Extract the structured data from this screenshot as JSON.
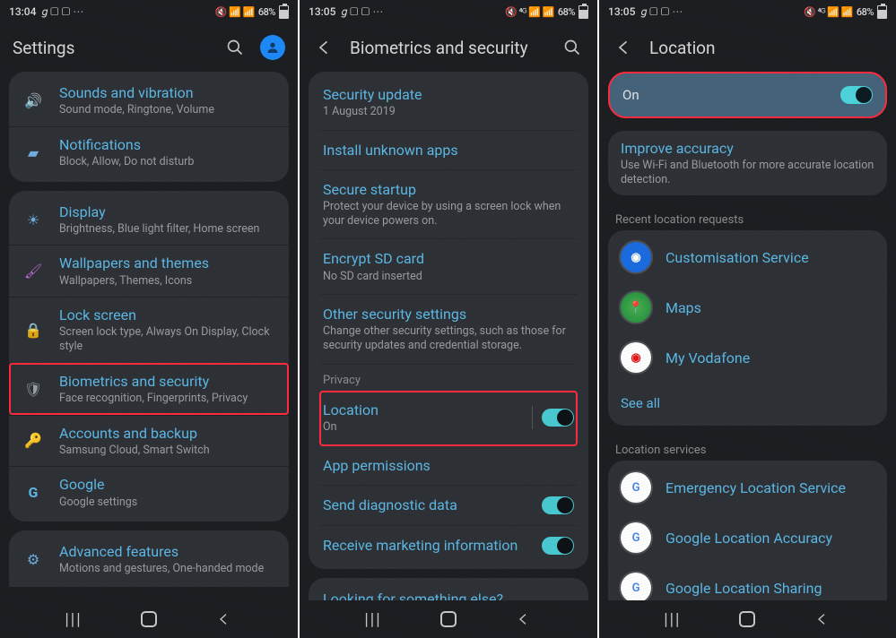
{
  "status": {
    "time1": "13:04",
    "time2": "13:05",
    "time3": "13:05",
    "left_icons": "9 ⬚ ⬚ ⋯",
    "right_text": "68%"
  },
  "panel1": {
    "title": "Settings",
    "groups": [
      [
        {
          "icon": "sound",
          "title": "Sounds and vibration",
          "sub": "Sound mode, Ringtone, Volume"
        },
        {
          "icon": "notif",
          "title": "Notifications",
          "sub": "Block, Allow, Do not disturb"
        }
      ],
      [
        {
          "icon": "display",
          "title": "Display",
          "sub": "Brightness, Blue light filter, Home screen"
        },
        {
          "icon": "wallpaper",
          "title": "Wallpapers and themes",
          "sub": "Wallpapers, Themes, Icons"
        },
        {
          "icon": "lock",
          "title": "Lock screen",
          "sub": "Screen lock type, Always On Display, Clock style"
        },
        {
          "icon": "shield",
          "title": "Biometrics and security",
          "sub": "Face recognition, Fingerprints, Privacy",
          "hl": true
        },
        {
          "icon": "key",
          "title": "Accounts and backup",
          "sub": "Samsung Cloud, Smart Switch"
        },
        {
          "icon": "google",
          "title": "Google",
          "sub": "Google settings"
        }
      ],
      [
        {
          "icon": "adv",
          "title": "Advanced features",
          "sub": "Motions and gestures, One-handed mode"
        }
      ]
    ]
  },
  "panel2": {
    "title": "Biometrics and security",
    "top": [
      {
        "title": "Security update",
        "sub": "1 August 2019"
      },
      {
        "title": "Install unknown apps"
      },
      {
        "title": "Secure startup",
        "sub": "Protect your device by using a screen lock when your device powers on."
      },
      {
        "title": "Encrypt SD card",
        "sub": "No SD card inserted"
      },
      {
        "title": "Other security settings",
        "sub": "Change other security settings, such as those for security updates and credential storage."
      }
    ],
    "privacy_label": "Privacy",
    "privacy": [
      {
        "title": "Location",
        "sub": "On",
        "toggle": true,
        "hl": true
      },
      {
        "title": "App permissions"
      },
      {
        "title": "Send diagnostic data",
        "toggle": true
      },
      {
        "title": "Receive marketing information",
        "toggle": true
      }
    ],
    "footer": "Looking for something else?"
  },
  "panel3": {
    "title": "Location",
    "master": "On",
    "improve_title": "Improve accuracy",
    "improve_sub": "Use Wi-Fi and Bluetooth for more accurate location detection.",
    "recent_label": "Recent location requests",
    "recent": [
      {
        "color": "#1a6be0",
        "letter": "◉",
        "name": "Customisation Service"
      },
      {
        "color": "#1aa84a",
        "letter": "▲",
        "name": "Maps"
      },
      {
        "color": "#e01a1a",
        "letter": "O",
        "name": "My Vodafone"
      }
    ],
    "seeall": "See all",
    "services_label": "Location services",
    "services": [
      {
        "name": "Emergency Location Service"
      },
      {
        "name": "Google Location Accuracy"
      },
      {
        "name": "Google Location Sharing"
      }
    ]
  }
}
